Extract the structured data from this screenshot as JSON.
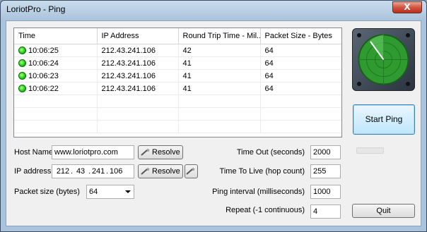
{
  "window": {
    "title": "LoriotPro - Ping",
    "close_label": "X"
  },
  "table": {
    "columns": [
      "Time",
      "IP Address",
      "Round Trip Time - Mil...",
      "Packet Size - Bytes"
    ],
    "rows": [
      {
        "time": "10:06:25",
        "ip": "212.43.241.106",
        "rtt": "42",
        "size": "64",
        "status": "ok"
      },
      {
        "time": "10:06:24",
        "ip": "212.43.241.106",
        "rtt": "41",
        "size": "64",
        "status": "ok"
      },
      {
        "time": "10:06:23",
        "ip": "212.43.241.106",
        "rtt": "41",
        "size": "64",
        "status": "ok"
      },
      {
        "time": "10:06:22",
        "ip": "212.43.241.106",
        "rtt": "41",
        "size": "64",
        "status": "ok"
      }
    ]
  },
  "form": {
    "host_name_label": "Host Name",
    "host_name_value": "www.loriotpro.com",
    "ip_address_label": "IP address",
    "ip_octets": [
      "212",
      "43",
      "241",
      "106"
    ],
    "ip_separator": ".",
    "resolve_label": "Resolve",
    "packet_size_label": "Packet size (bytes)",
    "packet_size_value": "64",
    "timeout_label": "Time Out (seconds)",
    "timeout_value": "2000",
    "ttl_label": "Time To Live (hop count)",
    "ttl_value": "255",
    "interval_label": "Ping interval (milliseconds)",
    "interval_value": "1000",
    "repeat_label": "Repeat (-1 continuous)",
    "repeat_value": "4"
  },
  "buttons": {
    "start_ping": "Start Ping",
    "quit": "Quit"
  },
  "colors": {
    "status_ok": "#1fcf1f",
    "radar_green": "#2f9a2f",
    "accent_button": "#bee6fd"
  },
  "icons": {
    "resolve": "wand-icon",
    "radar": "radar-icon"
  }
}
